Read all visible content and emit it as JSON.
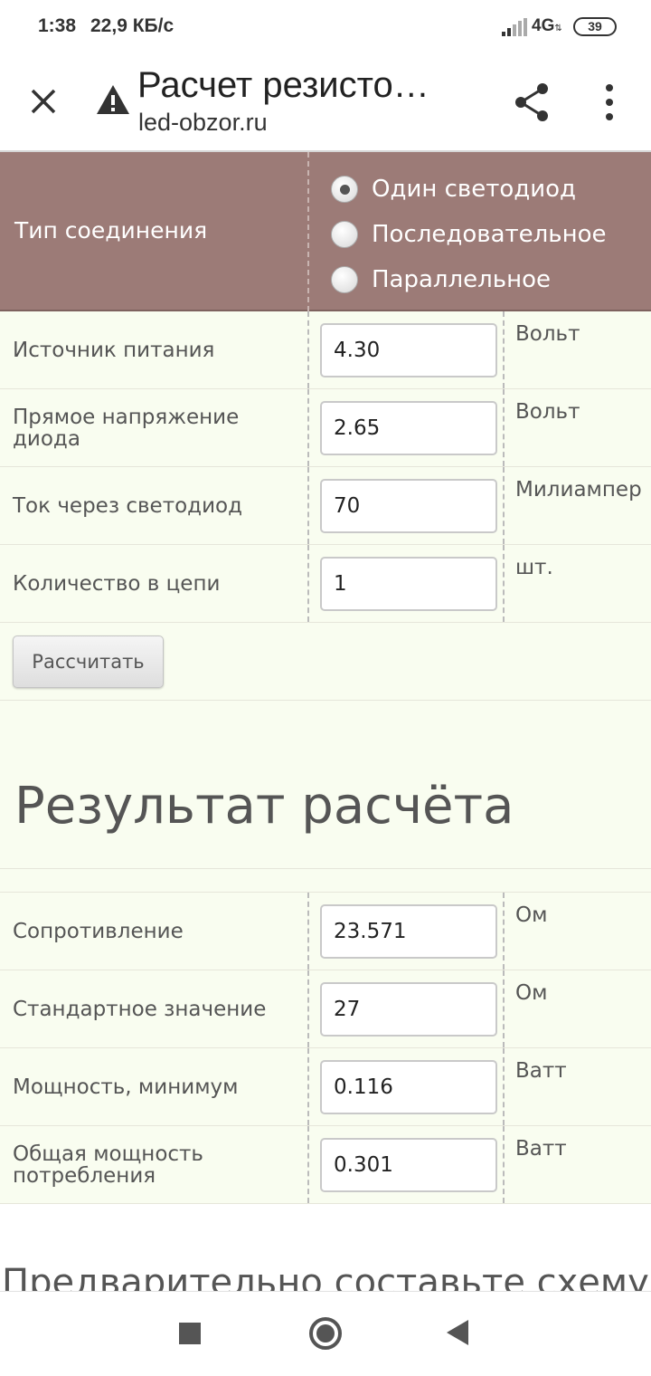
{
  "status_bar": {
    "time": "1:38",
    "speed": "22,9 КБ/с",
    "network": "4G",
    "battery": "39"
  },
  "tab_bar": {
    "title": "Расчет резисто…",
    "url": "led-obzor.ru",
    "icons": [
      "close-icon",
      "warning-icon",
      "share-icon",
      "more-vert-icon"
    ]
  },
  "form": {
    "connection_label": "Тип соединения",
    "connection_options": [
      {
        "label": "Один светодиод",
        "checked": true
      },
      {
        "label": "Последовательное",
        "checked": false
      },
      {
        "label": "Параллельное",
        "checked": false
      }
    ],
    "inputs": [
      {
        "label": "Источник питания",
        "value": "4.30",
        "unit": "Вольт"
      },
      {
        "label": "Прямое напряжение диода",
        "value": "2.65",
        "unit": "Вольт"
      },
      {
        "label": "Ток через светодиод",
        "value": "70",
        "unit": "Милиампер"
      },
      {
        "label": "Количество в цепи",
        "value": "1",
        "unit": "шт."
      }
    ],
    "calculate_button": "Рассчитать"
  },
  "result": {
    "title": "Результат расчёта",
    "rows": [
      {
        "label": "Сопротивление",
        "value": "23.571",
        "unit": "Ом"
      },
      {
        "label": "Стандартное значение",
        "value": "27",
        "unit": "Ом"
      },
      {
        "label": "Мощность, минимум",
        "value": "0.116",
        "unit": "Ватт"
      },
      {
        "label": "Общая мощность потребления",
        "value": "0.301",
        "unit": "Ватт"
      }
    ]
  },
  "next_heading": "Предварительно составьте схему",
  "colors": {
    "header_bg": "#9c7b77",
    "row_bg": "#f9fdf0"
  }
}
